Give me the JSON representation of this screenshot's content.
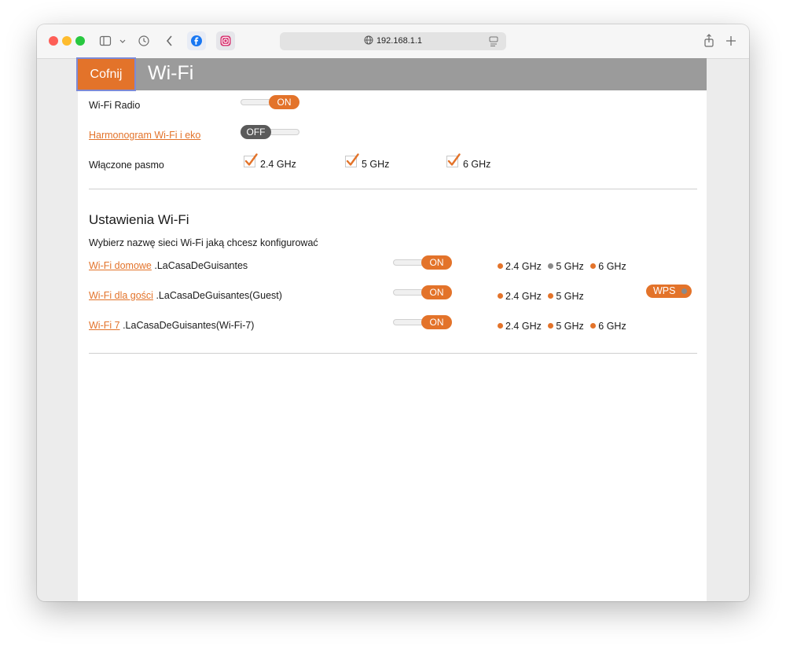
{
  "browser": {
    "url": "192.168.1.1",
    "colors": {
      "close": "#fe5f57",
      "minimize": "#febc2e",
      "zoom": "#28c840"
    }
  },
  "header": {
    "back_label": "Cofnij",
    "title": "Wi-Fi"
  },
  "general": {
    "radio_label": "Wi-Fi Radio",
    "radio_state": "ON",
    "schedule_link": "Harmonogram Wi-Fi i eko",
    "schedule_state": "OFF",
    "band_label": "Włączone pasmo",
    "bands": [
      {
        "label": "2.4 GHz",
        "checked": true
      },
      {
        "label": "5 GHz",
        "checked": true
      },
      {
        "label": "6 GHz",
        "checked": true
      }
    ]
  },
  "settings": {
    "title": "Ustawienia Wi-Fi",
    "subtitle": "Wybierz nazwę sieci Wi-Fi jaką chcesz konfigurować",
    "networks": [
      {
        "link": "Wi-Fi domowe",
        "ssid": ".LaCasaDeGuisantes",
        "state": "ON",
        "bands": [
          {
            "label": "2.4 GHz",
            "color": "orange"
          },
          {
            "label": "5 GHz",
            "color": "gray"
          },
          {
            "label": "6 GHz",
            "color": "orange"
          }
        ],
        "wps": "WPS"
      },
      {
        "link": "Wi-Fi dla gości",
        "ssid": ".LaCasaDeGuisantes(Guest)",
        "state": "ON",
        "bands": [
          {
            "label": "2.4 GHz",
            "color": "orange"
          },
          {
            "label": "5 GHz",
            "color": "orange"
          }
        ]
      },
      {
        "link": "Wi-Fi 7",
        "ssid": ".LaCasaDeGuisantes(Wi-Fi-7)",
        "state": "ON",
        "bands": [
          {
            "label": "2.4 GHz",
            "color": "orange"
          },
          {
            "label": "5 GHz",
            "color": "orange"
          },
          {
            "label": "6 GHz",
            "color": "orange"
          }
        ]
      }
    ]
  },
  "colors": {
    "accent": "#e3732a",
    "header_bg": "#9b9b9b",
    "toggle_off": "#5a5a5a"
  }
}
